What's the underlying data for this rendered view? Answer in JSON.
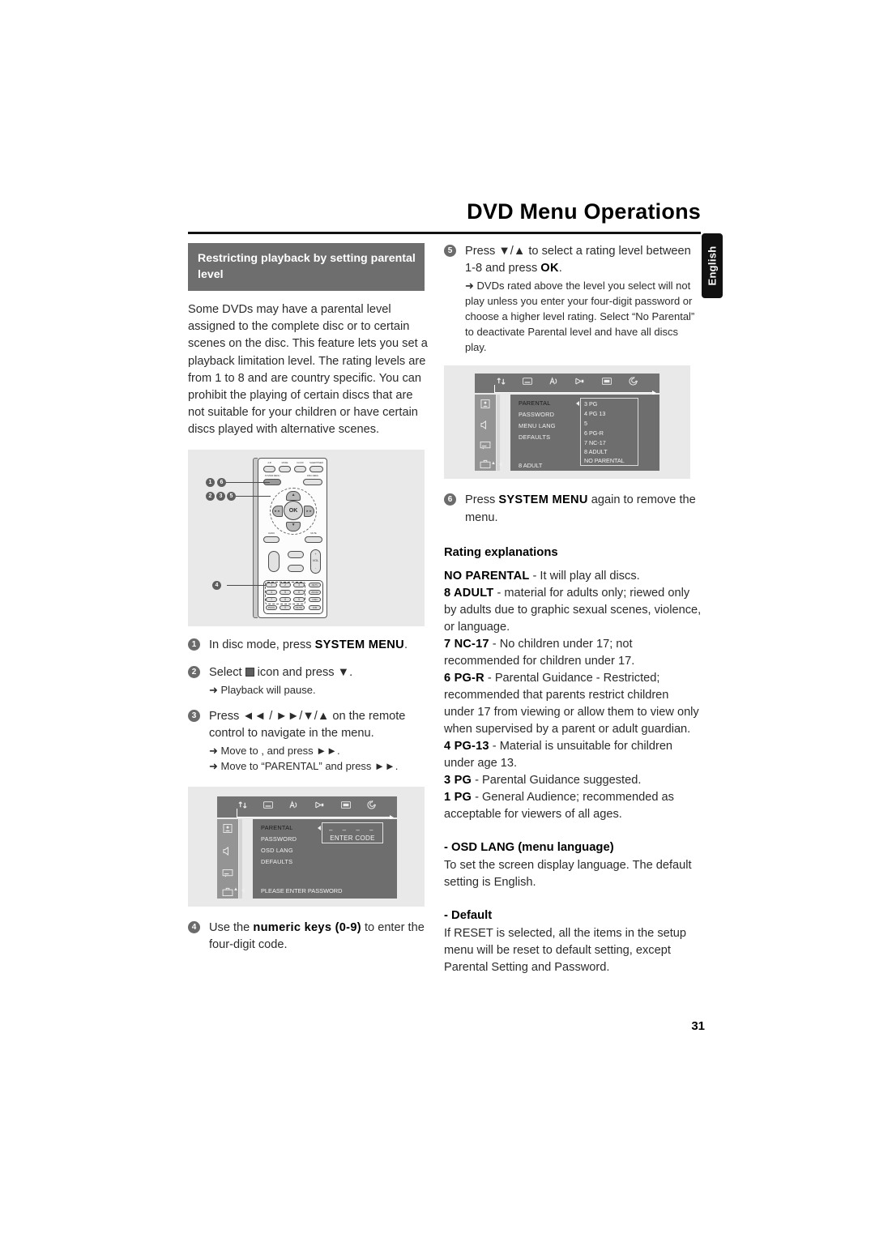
{
  "header": {
    "title": "DVD Menu Operations",
    "language_tab": "English"
  },
  "page_number": "31",
  "left_column": {
    "section_banner": "Restricting playback by setting parental level",
    "intro": "Some DVDs may have a parental level assigned to the complete disc or to certain scenes on the disc. This feature lets you set a playback limitation level. The rating levels are from 1 to 8 and are country specific. You can prohibit the playing of certain discs that are not suitable for your children or have certain discs played with alternative scenes.",
    "steps": [
      {
        "num": "1",
        "text_before": "In disc mode, press ",
        "bold": "SYSTEM MENU",
        "text_after": ".",
        "sub_lines": []
      },
      {
        "num": "2",
        "text_before": "Select ",
        "bold": "",
        "text_after": " icon and press ▼.",
        "sub_lines": [
          "➜ Playback will pause."
        ]
      },
      {
        "num": "3",
        "text_before": "Press ◄◄ / ►►/▼/▲  on the remote control to navigate in the menu.",
        "bold": "",
        "text_after": "",
        "sub_lines": [
          "➜ Move to , and press ►►.",
          "➜ Move to “PARENTAL” and press ►►."
        ]
      },
      {
        "num": "4",
        "text_before": "Use the ",
        "bold": "numeric keys (0-9)",
        "text_after": " to enter the four-digit code.",
        "sub_lines": []
      }
    ],
    "remote_figure": {
      "top_buttons": [
        "A-B",
        "MODE",
        "CLOCK",
        "SLEEP/TIMER"
      ],
      "second_row": [
        "SYSTEM MENU",
        "DISC MENU"
      ],
      "ok_label": "OK",
      "nav_left": "◄◄",
      "nav_right": "►►",
      "nav_up": "▲",
      "nav_down": "▼",
      "below_nav": [
        "AUDIO",
        "MUTE"
      ],
      "mid_buttons": [
        "►▐",
        "▌◄",
        "N/X",
        "■",
        "+",
        "VOL",
        "-"
      ],
      "keypad": [
        "1",
        "2",
        "3",
        "4",
        "5",
        "6",
        "7",
        "8",
        "9",
        "PROG",
        "0",
        "MUTE"
      ],
      "side_keys": [
        "RETN",
        "ZOOM",
        "OSD",
        "DIM"
      ],
      "callouts": [
        "1",
        "6",
        "2",
        "3",
        "5",
        "4"
      ]
    },
    "osd_figure": {
      "menu_items": [
        "PARENTAL",
        "PASSWORD",
        "OSD LANG",
        "DEFAULTS"
      ],
      "status_line": "PLEASE ENTER PASSWORD",
      "enter_code": {
        "dashes": "–   –   –   –",
        "label": "ENTER CODE"
      },
      "top_icons": [
        "updown-arrows-icon",
        "subtitle-icon",
        "language-note-icon",
        "play-video-icon",
        "tv-screen-icon",
        "disc-spiral-icon"
      ],
      "side_icons": [
        "picture-icon",
        "speaker-icon",
        "subtitle-box-icon",
        "setup-case-icon"
      ]
    }
  },
  "right_column": {
    "steps": [
      {
        "num": "5",
        "line1_a": "Press ▼/▲  to select a rating level between 1-8 and press ",
        "line1_bold": "OK",
        "line1_b": ".",
        "sub_lines": [
          "➜ DVDs rated above the level you select will not play unless you enter your four-digit password or choose a higher level rating. Select “No Parental” to deactivate Parental level and have all discs play."
        ]
      },
      {
        "num": "6",
        "line1_a": "Press ",
        "line1_bold": "SYSTEM MENU",
        "line1_b": " again to remove the menu.",
        "sub_lines": []
      }
    ],
    "osd_figure": {
      "menu_items": [
        "PARENTAL",
        "PASSWORD",
        "MENU LANG",
        "DEFAULTS"
      ],
      "status_line": "8 ADULT",
      "rating_popup": [
        "3 PG",
        "4 PG 13",
        "5",
        "6 PG-R",
        "7 NC-17",
        "8 ADULT",
        "NO PARENTAL"
      ],
      "top_icons": [
        "updown-arrows-icon",
        "subtitle-icon",
        "language-note-icon",
        "play-video-icon",
        "tv-screen-icon",
        "disc-spiral-icon"
      ],
      "side_icons": [
        "picture-icon",
        "speaker-icon",
        "subtitle-box-icon",
        "setup-case-icon"
      ]
    },
    "rating_explanations_heading": "Rating explanations",
    "ratings": [
      {
        "label": "NO PARENTAL",
        "text": " - It will play all discs."
      },
      {
        "label": "8 ADULT",
        "text": " - material for adults only; riewed only by adults due to graphic sexual scenes, violence, or language."
      },
      {
        "label": "7 NC-17",
        "text": " - No children under 17; not recommended for children under 17."
      },
      {
        "label": "6 PG-R",
        "text": " - Parental Guidance - Restricted; recommended that parents restrict children under 17 from viewing or allow them to view only when supervised by a parent or adult guardian."
      },
      {
        "label": "4 PG-13",
        "text": " - Material  is unsuitable for children under age 13."
      },
      {
        "label": "3 PG",
        "text": " - Parental Guidance suggested."
      },
      {
        "label": "1 PG",
        "text": " - General Audience; recommended as acceptable for viewers of all ages."
      }
    ],
    "osd_lang_heading": "- OSD LANG (menu language)",
    "osd_lang_body": "To set the screen display language. The default setting is English.",
    "default_heading": "- Default",
    "default_body": "If RESET is selected, all the items in the setup menu will be reset to default setting,  except Parental Setting and Password."
  }
}
